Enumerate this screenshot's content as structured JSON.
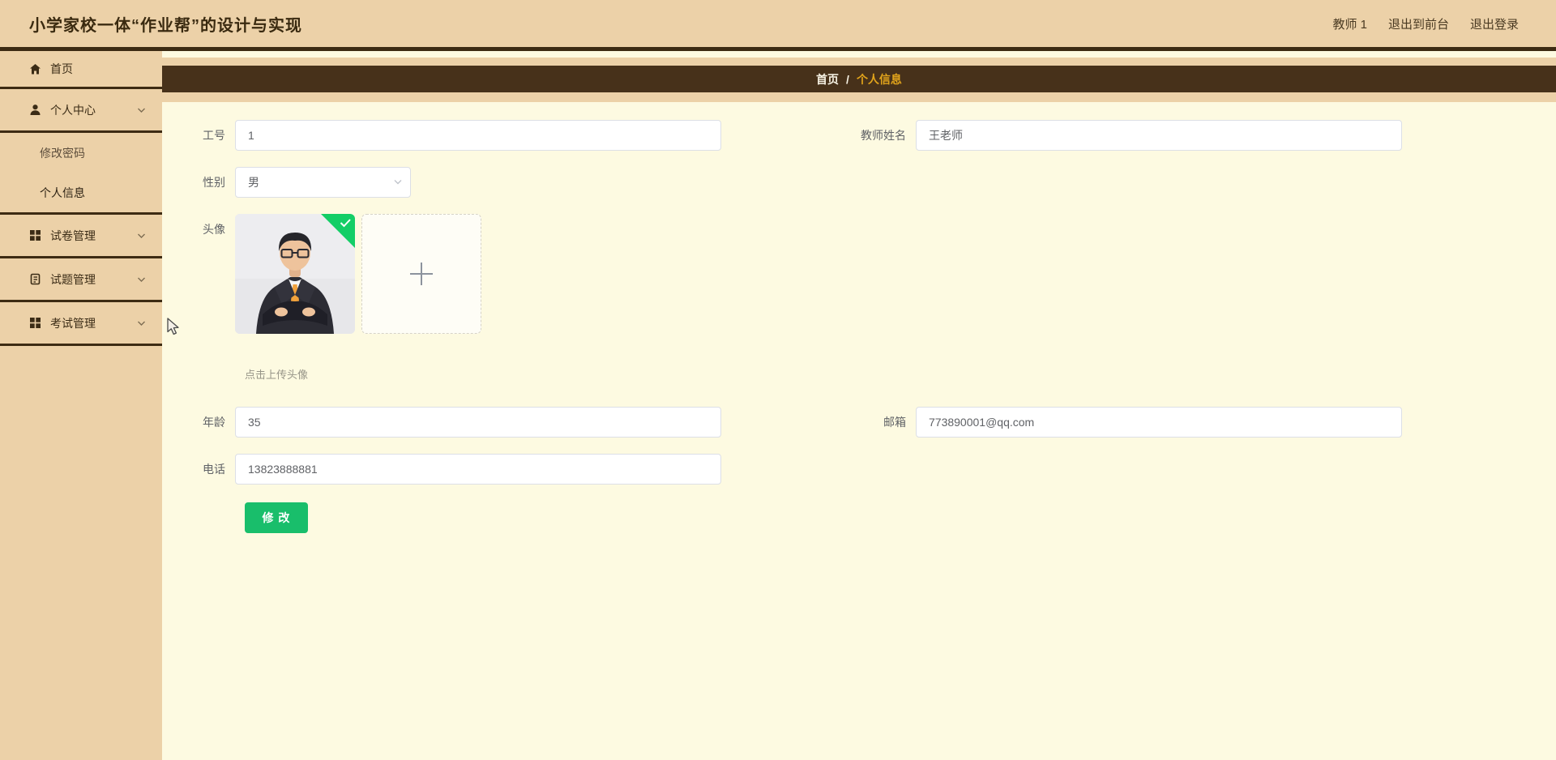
{
  "header": {
    "title": "小学家校一体“作业帮”的设计与实现",
    "user_label": "教师 1",
    "exit_front_label": "退出到前台",
    "logout_label": "退出登录"
  },
  "sidebar": {
    "home": {
      "label": "首页",
      "icon": "home-icon"
    },
    "personal_center": {
      "label": "个人中心",
      "icon": "user-icon",
      "expanded": true,
      "children": [
        {
          "label": "修改密码"
        },
        {
          "label": "个人信息",
          "active": true
        }
      ]
    },
    "paper_mgmt": {
      "label": "试卷管理",
      "icon": "grid-icon"
    },
    "question_mgmt": {
      "label": "试题管理",
      "icon": "clipboard-icon"
    },
    "exam_mgmt": {
      "label": "考试管理",
      "icon": "grid-icon"
    }
  },
  "breadcrumb": {
    "home": "首页",
    "separator": "/",
    "current": "个人信息"
  },
  "form": {
    "work_id": {
      "label": "工号",
      "value": "1"
    },
    "teacher_name": {
      "label": "教师姓名",
      "value": "王老师"
    },
    "gender": {
      "label": "性别",
      "value": "男"
    },
    "avatar": {
      "label": "头像",
      "hint": "点击上传头像",
      "status": "uploaded"
    },
    "age": {
      "label": "年龄",
      "value": "35"
    },
    "email": {
      "label": "邮箱",
      "value": "773890001@qq.com"
    },
    "phone": {
      "label": "电话",
      "value": "13823888881"
    },
    "submit_label": "修 改"
  },
  "colors": {
    "header_bg": "#ecd1a8",
    "dark_bar": "#47311a",
    "content_bg": "#fdfae1",
    "breadcrumb_active": "#e2a41b",
    "button_green": "#19be6b",
    "badge_green": "#13ce66"
  }
}
